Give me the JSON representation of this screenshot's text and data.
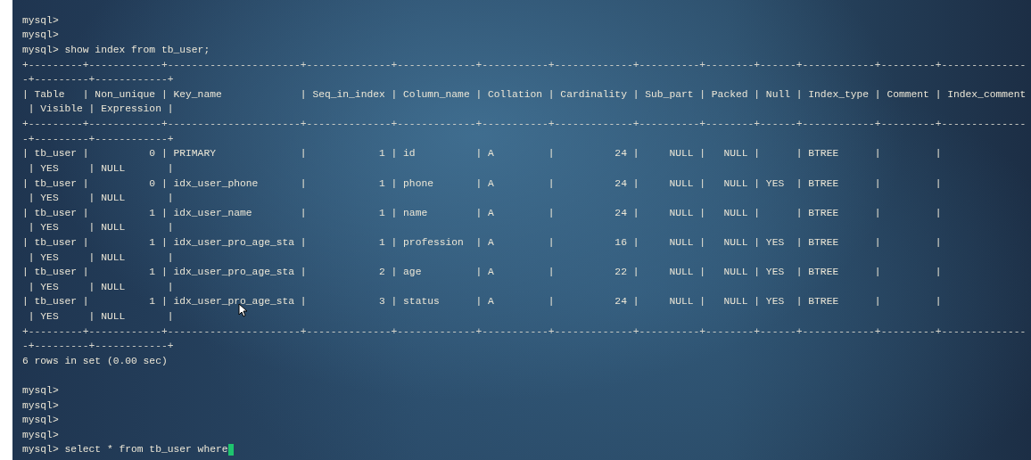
{
  "terminal": {
    "lines": [
      {
        "kind": "prompt",
        "text": "mysql>",
        "cursor": false
      },
      {
        "kind": "prompt",
        "text": "mysql>",
        "cursor": false
      },
      {
        "kind": "prompt",
        "text": "mysql> show index from tb_user;",
        "cursor": false
      },
      {
        "kind": "border",
        "text": "+---------+------------+----------------------+--------------+-------------+-----------+-------------+----------+--------+------+------------+---------+--------------",
        "cursor": false
      },
      {
        "kind": "border",
        "text": "-+---------+------------+",
        "cursor": false
      },
      {
        "kind": "header",
        "text": "| Table   | Non_unique | Key_name             | Seq_in_index | Column_name | Collation | Cardinality | Sub_part | Packed | Null | Index_type | Comment | Index_comment",
        "cursor": false
      },
      {
        "kind": "header",
        "text": " | Visible | Expression |",
        "cursor": false
      },
      {
        "kind": "border",
        "text": "+---------+------------+----------------------+--------------+-------------+-----------+-------------+----------+--------+------+------------+---------+--------------",
        "cursor": false
      },
      {
        "kind": "border",
        "text": "-+---------+------------+",
        "cursor": false
      },
      {
        "kind": "row",
        "text": "| tb_user |          0 | PRIMARY              |            1 | id          | A         |          24 |     NULL |   NULL |      | BTREE      |         |",
        "cursor": false
      },
      {
        "kind": "row",
        "text": " | YES     | NULL       |",
        "cursor": false
      },
      {
        "kind": "row",
        "text": "| tb_user |          0 | idx_user_phone       |            1 | phone       | A         |          24 |     NULL |   NULL | YES  | BTREE      |         |",
        "cursor": false
      },
      {
        "kind": "row",
        "text": " | YES     | NULL       |",
        "cursor": false
      },
      {
        "kind": "row",
        "text": "| tb_user |          1 | idx_user_name        |            1 | name        | A         |          24 |     NULL |   NULL |      | BTREE      |         |",
        "cursor": false
      },
      {
        "kind": "row",
        "text": " | YES     | NULL       |",
        "cursor": false
      },
      {
        "kind": "row",
        "text": "| tb_user |          1 | idx_user_pro_age_sta |            1 | profession  | A         |          16 |     NULL |   NULL | YES  | BTREE      |         |",
        "cursor": false
      },
      {
        "kind": "row",
        "text": " | YES     | NULL       |",
        "cursor": false
      },
      {
        "kind": "row",
        "text": "| tb_user |          1 | idx_user_pro_age_sta |            2 | age         | A         |          22 |     NULL |   NULL | YES  | BTREE      |         |",
        "cursor": false
      },
      {
        "kind": "row",
        "text": " | YES     | NULL       |",
        "cursor": false
      },
      {
        "kind": "row",
        "text": "| tb_user |          1 | idx_user_pro_age_sta |            3 | status      | A         |          24 |     NULL |   NULL | YES  | BTREE      |         |",
        "cursor": false
      },
      {
        "kind": "row",
        "text": " | YES     | NULL       |",
        "cursor": false
      },
      {
        "kind": "border",
        "text": "+---------+------------+----------------------+--------------+-------------+-----------+-------------+----------+--------+------+------------+---------+--------------",
        "cursor": false
      },
      {
        "kind": "border",
        "text": "-+---------+------------+",
        "cursor": false
      },
      {
        "kind": "message",
        "text": "6 rows in set (0.00 sec)",
        "cursor": false
      },
      {
        "kind": "blank",
        "cursor": false
      },
      {
        "kind": "prompt",
        "text": "mysql>",
        "cursor": false
      },
      {
        "kind": "prompt",
        "text": "mysql>",
        "cursor": false
      },
      {
        "kind": "prompt",
        "text": "mysql>",
        "cursor": false
      },
      {
        "kind": "prompt",
        "text": "mysql>",
        "cursor": false
      },
      {
        "kind": "prompt",
        "text": "mysql> select * from tb_user where",
        "cursor": true
      }
    ]
  }
}
